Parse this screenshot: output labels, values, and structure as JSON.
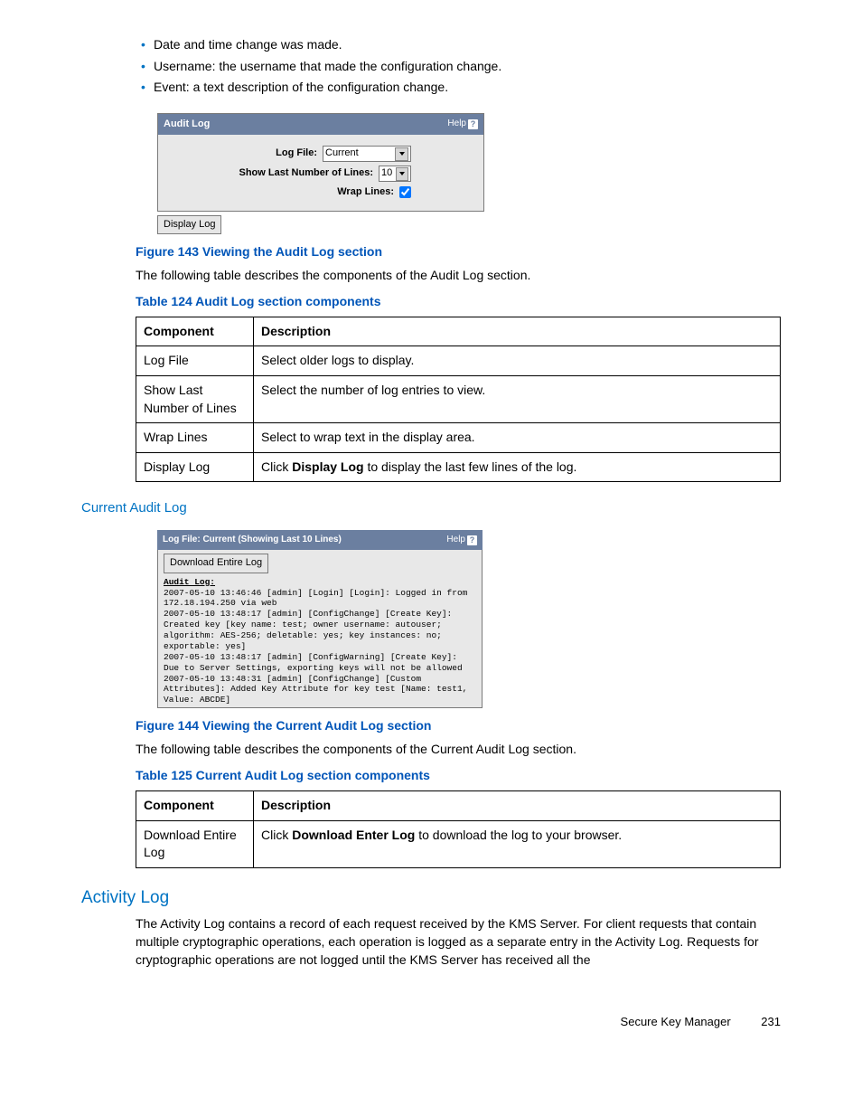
{
  "bullets": [
    "Date and time change was made.",
    "Username: the username that made the configuration change.",
    "Event: a text description of the configuration change."
  ],
  "fig1": {
    "title": "Audit Log",
    "help": "Help",
    "logfile_lbl": "Log File:",
    "logfile_val": "Current",
    "lines_lbl": "Show Last Number of Lines:",
    "lines_val": "10",
    "wrap_lbl": "Wrap Lines:",
    "display_btn": "Display Log"
  },
  "caption_fig1": "Figure 143 Viewing the Audit Log section",
  "intro1": "The following table describes the components of the Audit Log section.",
  "caption_tbl1": "Table 124 Audit Log section components",
  "table1": {
    "head": [
      "Component",
      "Description"
    ],
    "rows": [
      [
        "Log File",
        "Select older logs to display."
      ],
      [
        "Show Last Number of Lines",
        "Select the number of log entries to view."
      ],
      [
        "Wrap Lines",
        "Select to wrap text in the display area."
      ],
      [
        "Display Log",
        {
          "pre": "Click ",
          "b": "Display Log",
          "post": " to display the last few lines of the log."
        }
      ]
    ]
  },
  "section_current": "Current Audit Log",
  "fig2": {
    "title": "Log File: Current (Showing Last 10 Lines)",
    "help": "Help",
    "download_btn": "Download Entire Log",
    "audit_label": "Audit Log:",
    "log_text": "2007-05-10 13:46:46 [admin] [Login] [Login]: Logged in from 172.18.194.250 via web\n2007-05-10 13:48:17 [admin] [ConfigChange] [Create Key]: Created key [key name: test; owner username: autouser; algorithm: AES-256; deletable: yes; key instances: no; exportable: yes]\n2007-05-10 13:48:17 [admin] [ConfigWarning] [Create Key]: Due to Server Settings, exporting keys will not be allowed\n2007-05-10 13:48:31 [admin] [ConfigChange] [Custom Attributes]: Added Key Attribute for key test [Name: test1, Value: ABCDE]"
  },
  "caption_fig2": "Figure 144 Viewing the Current Audit Log section",
  "intro2": "The following table describes the components of the Current Audit Log section.",
  "caption_tbl2": "Table 125 Current Audit Log section components",
  "table2": {
    "head": [
      "Component",
      "Description"
    ],
    "rows": [
      [
        "Download Entire Log",
        {
          "pre": "Click ",
          "b": "Download Enter Log",
          "post": " to download the log to your browser."
        }
      ]
    ]
  },
  "section_activity": "Activity Log",
  "activity_text": "The Activity Log contains a record of each request received by the KMS Server. For client requests that contain multiple cryptographic operations, each operation is logged as a separate entry in the Activity Log. Requests for cryptographic operations are not logged until the KMS Server has received all the",
  "footer_product": "Secure Key Manager",
  "footer_page": "231"
}
